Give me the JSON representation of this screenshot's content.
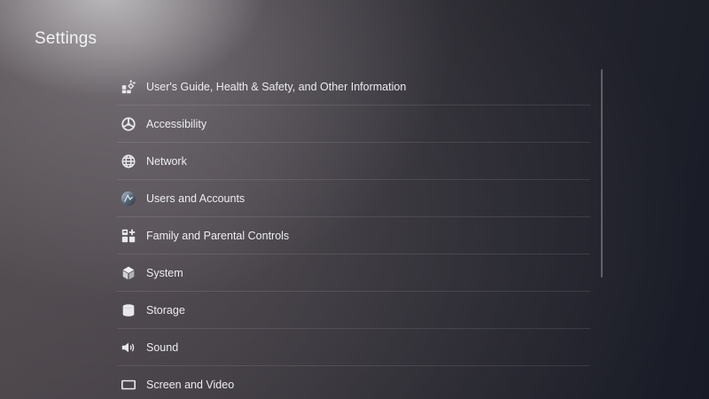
{
  "header": {
    "title": "Settings"
  },
  "settings": {
    "items": [
      {
        "label": "User's Guide, Health & Safety, and Other Information",
        "icon": "guide-icon"
      },
      {
        "label": "Accessibility",
        "icon": "accessibility-icon"
      },
      {
        "label": "Network",
        "icon": "globe-icon"
      },
      {
        "label": "Users and Accounts",
        "icon": "user-avatar-icon"
      },
      {
        "label": "Family and Parental Controls",
        "icon": "family-icon"
      },
      {
        "label": "System",
        "icon": "cube-icon"
      },
      {
        "label": "Storage",
        "icon": "storage-icon"
      },
      {
        "label": "Sound",
        "icon": "speaker-icon"
      },
      {
        "label": "Screen and Video",
        "icon": "screen-icon"
      }
    ]
  },
  "colors": {
    "text": "#ececf0",
    "background_dark": "#181b26",
    "background_light": "#4a4448"
  }
}
